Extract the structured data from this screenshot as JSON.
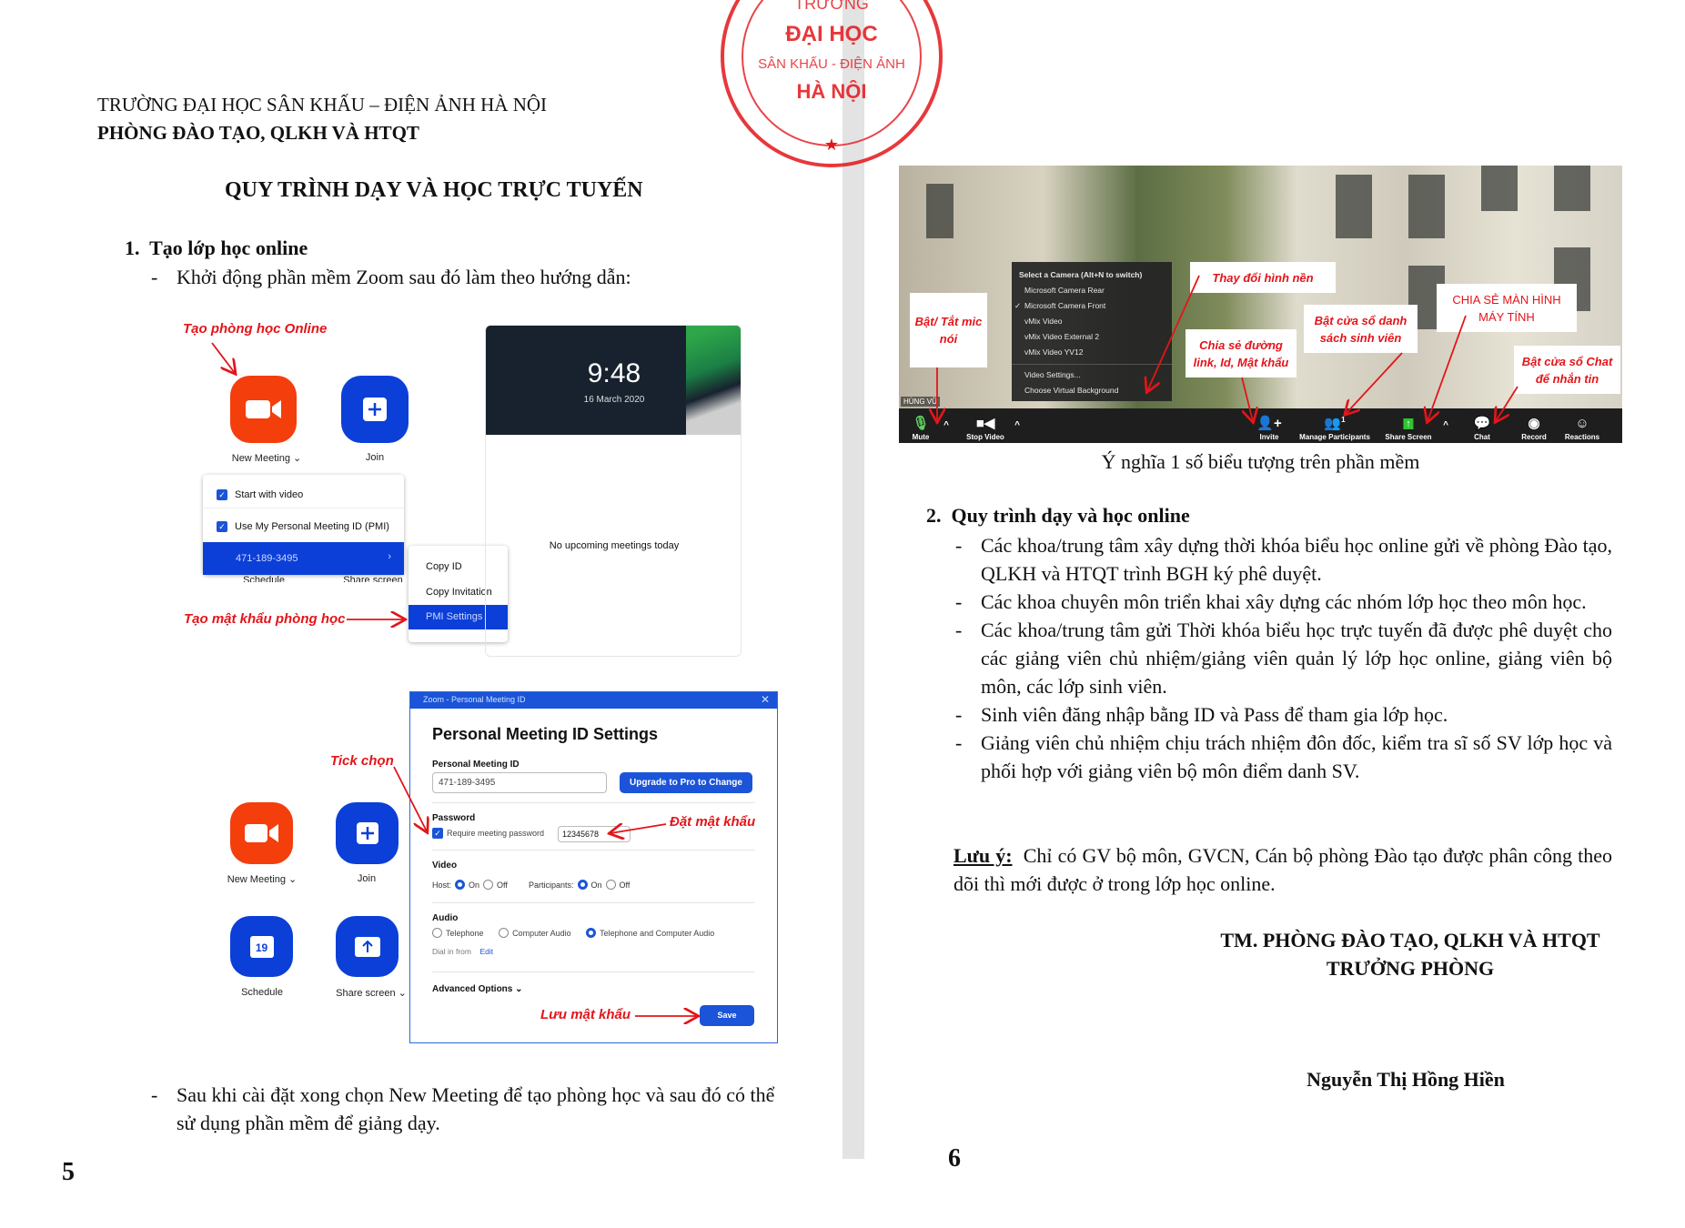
{
  "stamp": {
    "line1": "TRƯỜNG",
    "line2": "ĐẠI HỌC",
    "line3": "SÂN KHẤU - ĐIỆN ẢNH",
    "line4": "HÀ NỘI",
    "color": "#e3151a"
  },
  "page5": {
    "header_line1": "TRƯỜNG ĐẠI HỌC SÂN KHẤU – ĐIỆN ẢNH HÀ NỘI",
    "header_line2": "PHÒNG ĐÀO TẠO, QLKH VÀ HTQT",
    "title": "QUY TRÌNH DẠY VÀ HỌC TRỰC TUYẾN",
    "section1": {
      "number": "1.",
      "heading": "Tạo lớp học online",
      "bullet": "Khởi động phần mềm Zoom sau đó làm theo hướng dẫn:"
    },
    "fig1": {
      "annotation_create": "Tạo phòng học Online",
      "annotation_password": "Tạo mật khẩu phòng học",
      "new_meeting": "New Meeting",
      "join": "Join",
      "menu": {
        "start_with_video": "Start with video",
        "use_pmi": "Use My Personal Meeting ID (PMI)",
        "pmi": "471-189-3495",
        "behind_left": "Schedule",
        "behind_right": "Share screen"
      },
      "submenu": {
        "copy_id": "Copy ID",
        "copy_invitation": "Copy Invitation",
        "pmi_settings": "PMI Settings"
      },
      "clock": {
        "time": "9:48",
        "date": "16 March 2020"
      },
      "no_meetings": "No upcoming meetings today"
    },
    "fig2": {
      "annotation_tick": "Tick chọn",
      "annotation_set_password": "Đặt mật khẩu",
      "annotation_save": "Lưu mật khẩu",
      "new_meeting": "New Meeting",
      "join": "Join",
      "schedule": "Schedule",
      "schedule_day": "19",
      "share_screen": "Share screen",
      "dialog": {
        "window_title": "Zoom - Personal Meeting ID",
        "title": "Personal Meeting ID Settings",
        "pmi_label": "Personal Meeting ID",
        "pmi_value": "471-189-3495",
        "upgrade_button": "Upgrade to Pro to Change",
        "password_label": "Password",
        "require_password": "Require meeting password",
        "password_value": "12345678",
        "video_label": "Video",
        "host": "Host:",
        "participants": "Participants:",
        "on": "On",
        "off": "Off",
        "audio_label": "Audio",
        "telephone": "Telephone",
        "computer_audio": "Computer Audio",
        "both": "Telephone and Computer Audio",
        "dial_in": "Dial in from",
        "edit": "Edit",
        "advanced": "Advanced Options",
        "save": "Save"
      }
    },
    "final_bullet": "Sau khi cài đặt xong chọn New Meeting để tạo phòng học và sau đó có thể sử dụng phần mềm để giảng dạy.",
    "page_number": "5"
  },
  "page6": {
    "screenshot": {
      "camera_menu": {
        "title": "Select a Camera (Alt+N to switch)",
        "items": [
          "Microsoft Camera Rear",
          "Microsoft Camera Front",
          "vMix Video",
          "vMix Video External 2",
          "vMix Video YV12"
        ],
        "selected": "Microsoft Camera Front",
        "video_settings": "Video Settings...",
        "virtual_bg": "Choose Virtual Background"
      },
      "user_name": "HÙNG VŨ",
      "toolbar": {
        "mute": "Mute",
        "stop_video": "Stop Video",
        "invite": "Invite",
        "manage_participants": "Manage Participants",
        "participant_count": "1",
        "share_screen": "Share Screen",
        "chat": "Chat",
        "record": "Record",
        "reactions": "Reactions"
      },
      "callouts": {
        "mic": "Bật/ Tắt mic nói",
        "background": "Thay đổi hình nền",
        "invite": "Chia sẻ đường link, Id, Mật khẩu",
        "participants": "Bật cửa sổ danh sách sinh viên",
        "share": "CHIA SẺ MÀN HÌNH MÁY TÍNH",
        "chat": "Bật cửa sổ Chat để nhắn tin"
      }
    },
    "caption": "Ý nghĩa 1 số biểu tượng trên phần mềm",
    "section2": {
      "number": "2.",
      "heading": "Quy trình dạy và học online",
      "bullets": [
        "Các khoa/trung tâm xây dựng thời khóa biểu học online gửi về phòng Đào tạo, QLKH và HTQT trình BGH ký phê duyệt.",
        "Các khoa chuyên môn triển khai xây dựng các nhóm lớp học theo môn học.",
        "Các khoa/trung tâm gửi Thời khóa biểu học trực tuyến đã được phê duyệt cho các giảng viên chủ nhiệm/giảng viên quản lý lớp học online, giảng viên bộ môn, các lớp sinh viên.",
        "Sinh viên đăng nhập bằng ID và Pass để tham gia lớp học.",
        "Giảng viên chủ nhiệm chịu trách nhiệm đôn đốc, kiểm tra sĩ số SV lớp học và phối hợp với giảng viên bộ môn điểm danh SV."
      ]
    },
    "note_label": "Lưu ý:",
    "note_text": "Chỉ có GV bộ môn, GVCN, Cán bộ phòng Đào tạo được phân công theo dõi thì mới được ở trong lớp học online.",
    "signature_line1": "TM. PHÒNG ĐÀO TẠO, QLKH VÀ HTQT",
    "signature_line2": "TRƯỞNG PHÒNG",
    "signer": "Nguyễn Thị Hồng Hiền",
    "page_number": "6"
  }
}
